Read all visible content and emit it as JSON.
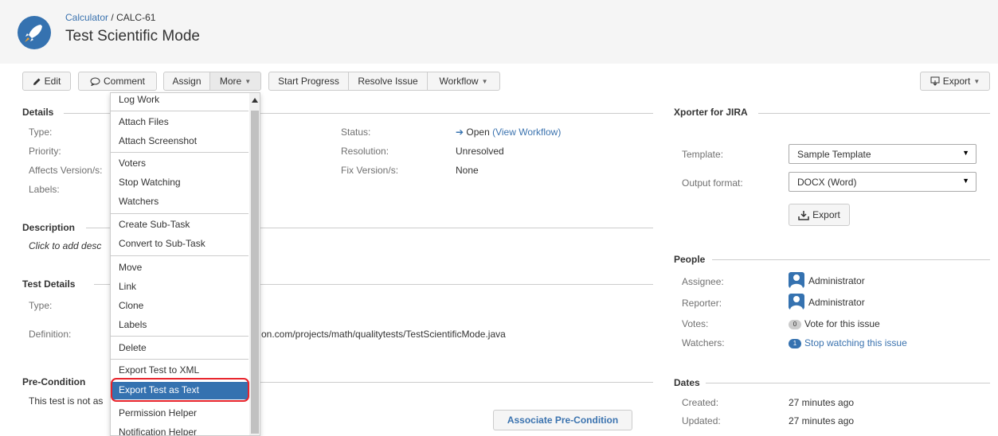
{
  "breadcrumb": {
    "project": "Calculator",
    "separator": "/",
    "issue_key": "CALC-61"
  },
  "issue": {
    "title": "Test Scientific Mode"
  },
  "toolbar": {
    "edit": "Edit",
    "comment": "Comment",
    "assign": "Assign",
    "more": "More",
    "start_progress": "Start Progress",
    "resolve": "Resolve Issue",
    "workflow": "Workflow",
    "export": "Export"
  },
  "details": {
    "heading": "Details",
    "type_label": "Type:",
    "priority_label": "Priority:",
    "affects_label": "Affects Version/s:",
    "labels_label": "Labels:",
    "status_label": "Status:",
    "status_value": "Open",
    "view_workflow": "(View Workflow)",
    "resolution_label": "Resolution:",
    "resolution_value": "Unresolved",
    "fix_label": "Fix Version/s:",
    "fix_value": "None"
  },
  "description": {
    "heading": "Description",
    "placeholder": "Click to add desc"
  },
  "test_details": {
    "heading": "Test Details",
    "type_label": "Type:",
    "definition_label": "Definition:",
    "definition_value": "on.com/projects/math/qualitytests/TestScientificMode.java"
  },
  "precondition": {
    "heading": "Pre-Condition",
    "text": "This test is not as",
    "associate_button": "Associate Pre-Condition"
  },
  "menu": {
    "items": [
      "Log Work",
      "Attach Files",
      "Attach Screenshot",
      "Voters",
      "Stop Watching",
      "Watchers",
      "Create Sub-Task",
      "Convert to Sub-Task",
      "Move",
      "Link",
      "Clone",
      "Labels",
      "Delete",
      "Export Test to XML",
      "Export Test as Text",
      "Permission Helper",
      "Notification Helper"
    ],
    "highlighted": "Export Test as Text"
  },
  "xporter": {
    "heading": "Xporter for JIRA",
    "template_label": "Template:",
    "template_value": "Sample Template",
    "format_label": "Output format:",
    "format_value": "DOCX (Word)",
    "export_button": "Export"
  },
  "people": {
    "heading": "People",
    "assignee_label": "Assignee:",
    "assignee": "Administrator",
    "reporter_label": "Reporter:",
    "reporter": "Administrator",
    "votes_label": "Votes:",
    "votes_count": "0",
    "votes_link": "Vote for this issue",
    "watchers_label": "Watchers:",
    "watchers_count": "1",
    "watchers_link": "Stop watching this issue"
  },
  "dates": {
    "heading": "Dates",
    "created_label": "Created:",
    "created": "27 minutes ago",
    "updated_label": "Updated:",
    "updated": "27 minutes ago"
  },
  "colors": {
    "accent": "#3572b0",
    "link": "#3b73af",
    "highlight_ring": "#e8232b"
  }
}
